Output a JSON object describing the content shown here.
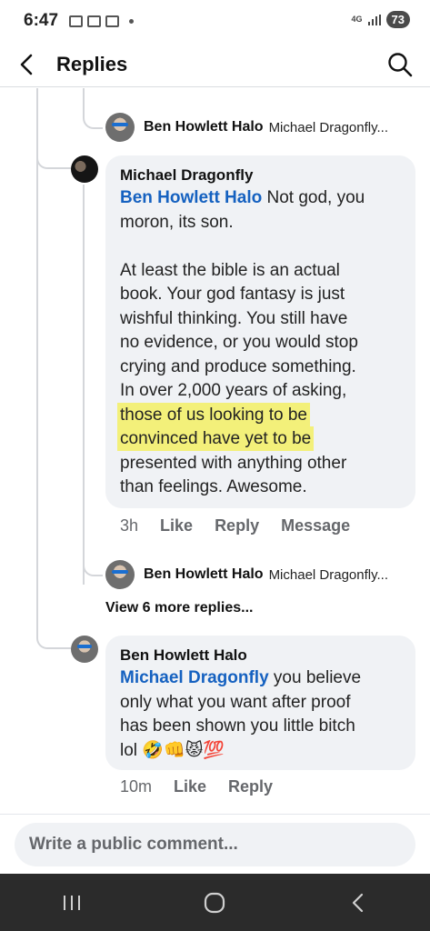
{
  "status": {
    "time": "6:47",
    "network": "4G",
    "battery": "73"
  },
  "header": {
    "title": "Replies"
  },
  "thread": {
    "top_reply": {
      "author": "Ben Howlett Halo",
      "preview": "Michael Dragonfly..."
    },
    "comment1": {
      "author": "Michael Dragonfly",
      "mention": "Ben Howlett Halo",
      "lines": [
        " Not god, you",
        "moron, its son.",
        "",
        "At least the bible is an actual",
        "book. Your god fantasy is just",
        "wishful thinking. You still have",
        "no evidence, or you would stop",
        "crying and produce something.",
        "In over 2,000 years of asking,",
        "those of us looking to be",
        "convinced have yet to be",
        "presented with anything other",
        "than feelings. Awesome."
      ],
      "time": "3h",
      "like": "Like",
      "reply": "Reply",
      "message": "Message"
    },
    "nested_reply": {
      "author": "Ben Howlett Halo",
      "preview": "Michael Dragonfly..."
    },
    "view_more": "View 6 more replies...",
    "comment2": {
      "author": "Ben Howlett Halo",
      "mention": "Michael Dragonfly",
      "lines": [
        " you believe",
        "only what you want after proof",
        "has been shown you little bitch",
        "lol 🤣👊😾💯"
      ],
      "time": "10m",
      "like": "Like",
      "reply": "Reply"
    }
  },
  "composer": {
    "placeholder": "Write a public comment..."
  },
  "colors": {
    "mention": "#1561c0",
    "highlight": "#f3f07a",
    "bubble": "#f0f2f5",
    "navbar": "#2b2b2b"
  }
}
